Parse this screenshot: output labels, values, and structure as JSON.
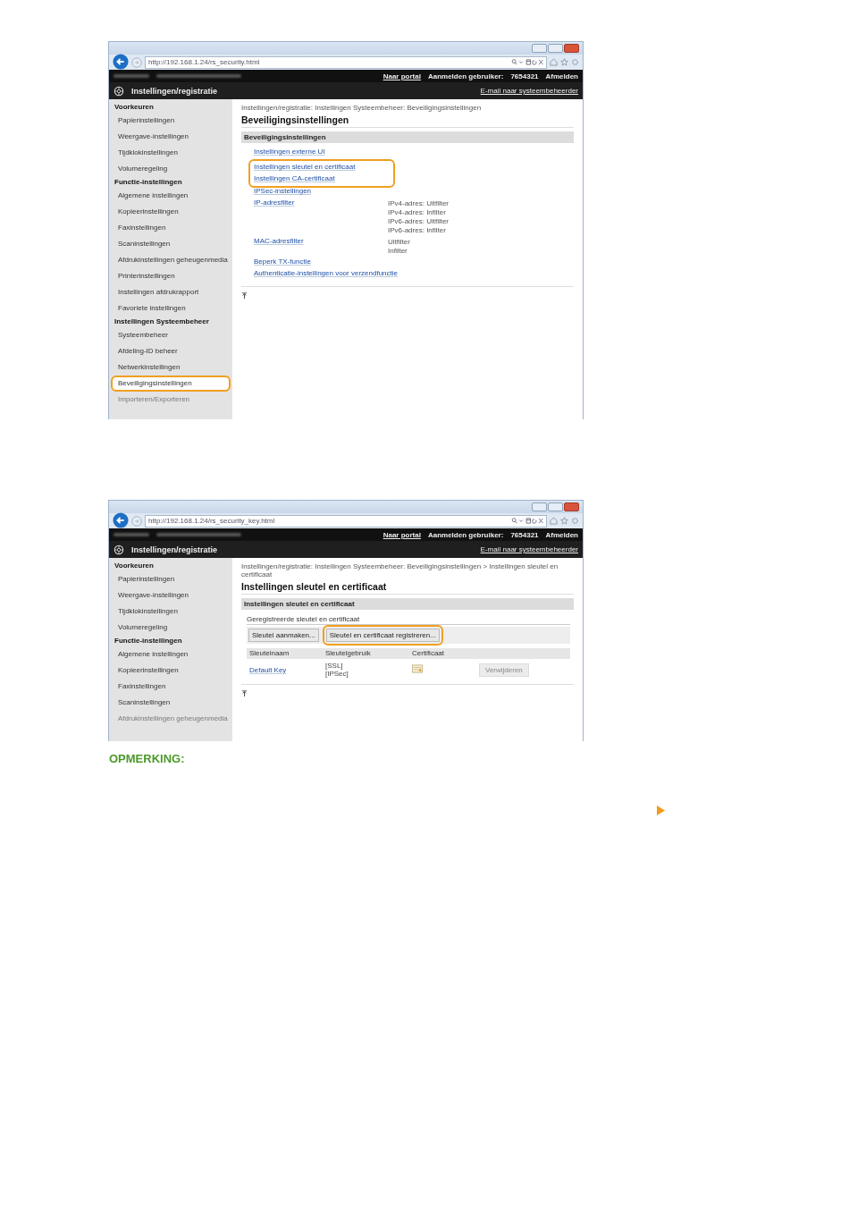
{
  "screenshots": [
    {
      "kind": "security",
      "address": "http://192.168.1.24/rs_security.html",
      "top_links": {
        "portal": "Naar portal",
        "user_label": "Aanmelden gebruiker:",
        "user_value": "7654321",
        "logout": "Afmelden"
      },
      "app_title": "Instellingen/registratie",
      "admin_email": "E-mail naar systeembeheerder",
      "sidebar": [
        {
          "kind": "heading",
          "label": "Voorkeuren"
        },
        {
          "kind": "item",
          "label": "Papierinstellingen",
          "highlighted": false,
          "faded": false
        },
        {
          "kind": "item",
          "label": "Weergave-instellingen",
          "highlighted": false,
          "faded": false
        },
        {
          "kind": "item",
          "label": "Tijdklokinstellingen",
          "highlighted": false,
          "faded": false
        },
        {
          "kind": "item",
          "label": "Volumeregeling",
          "highlighted": false,
          "faded": false
        },
        {
          "kind": "heading",
          "label": "Functie-instellingen"
        },
        {
          "kind": "item",
          "label": "Algemene instellingen",
          "highlighted": false,
          "faded": false
        },
        {
          "kind": "item",
          "label": "Kopieerinstellingen",
          "highlighted": false,
          "faded": false
        },
        {
          "kind": "item",
          "label": "Faxinstellingen",
          "highlighted": false,
          "faded": false
        },
        {
          "kind": "item",
          "label": "Scaninstellingen",
          "highlighted": false,
          "faded": false
        },
        {
          "kind": "item",
          "label": "Afdrukinstellingen geheugenmedia",
          "highlighted": false,
          "faded": false
        },
        {
          "kind": "item",
          "label": "Printerinstellingen",
          "highlighted": false,
          "faded": false
        },
        {
          "kind": "item",
          "label": "Instellingen afdrukrapport",
          "highlighted": false,
          "faded": false
        },
        {
          "kind": "item",
          "label": "Favoriete instellingen",
          "highlighted": false,
          "faded": false
        },
        {
          "kind": "heading",
          "label": "Instellingen Systeembeheer"
        },
        {
          "kind": "item",
          "label": "Systeembeheer",
          "highlighted": false,
          "faded": false
        },
        {
          "kind": "item",
          "label": "Afdeling-ID beheer",
          "highlighted": false,
          "faded": false
        },
        {
          "kind": "item",
          "label": "Netwerkinstellingen",
          "highlighted": false,
          "faded": false
        },
        {
          "kind": "item",
          "label": "Beveiligingsinstellingen",
          "highlighted": true,
          "faded": false
        },
        {
          "kind": "item",
          "label": "Importeren/Exporteren",
          "highlighted": false,
          "faded": true
        }
      ],
      "breadcrumb": "Instellingen/registratie: Instellingen Systeembeheer: Beveiligingsinstellingen",
      "title": "Beveiligingsinstellingen",
      "section": "Beveiligingsinstellingen",
      "links": [
        {
          "label": "Instellingen externe UI",
          "highlighted": false
        },
        {
          "label": "Instellingen sleutel en certificaat",
          "highlighted": true
        },
        {
          "label": "Instellingen CA-certificaat",
          "highlighted": true
        },
        {
          "label": "IPSec-instellingen",
          "highlighted": false
        },
        {
          "label": "IP-adresfilter",
          "highlighted": false,
          "values": [
            "IPv4-adres: Uitfilter",
            "IPv4-adres: Infilter",
            "IPv6-adres: Uitfilter",
            "IPv6-adres: Infilter"
          ]
        },
        {
          "label": "MAC-adresfilter",
          "highlighted": false,
          "values": [
            "Uitfilter",
            "Infilter"
          ]
        },
        {
          "label": "Beperk TX-functie",
          "highlighted": false
        },
        {
          "label": "Authenticatie-instellingen voor verzendfunctie",
          "highlighted": false
        }
      ]
    },
    {
      "kind": "keys",
      "address": "http://192.168.1.24/rs_security_key.html",
      "top_links": {
        "portal": "Naar portal",
        "user_label": "Aanmelden gebruiker:",
        "user_value": "7654321",
        "logout": "Afmelden"
      },
      "app_title": "Instellingen/registratie",
      "admin_email": "E-mail naar systeembeheerder",
      "sidebar": [
        {
          "kind": "heading",
          "label": "Voorkeuren"
        },
        {
          "kind": "item",
          "label": "Papierinstellingen",
          "highlighted": false,
          "faded": false
        },
        {
          "kind": "item",
          "label": "Weergave-instellingen",
          "highlighted": false,
          "faded": false
        },
        {
          "kind": "item",
          "label": "Tijdklokinstellingen",
          "highlighted": false,
          "faded": false
        },
        {
          "kind": "item",
          "label": "Volumeregeling",
          "highlighted": false,
          "faded": false
        },
        {
          "kind": "heading",
          "label": "Functie-instellingen"
        },
        {
          "kind": "item",
          "label": "Algemene instellingen",
          "highlighted": false,
          "faded": false
        },
        {
          "kind": "item",
          "label": "Kopieerinstellingen",
          "highlighted": false,
          "faded": false
        },
        {
          "kind": "item",
          "label": "Faxinstellingen",
          "highlighted": false,
          "faded": false
        },
        {
          "kind": "item",
          "label": "Scaninstellingen",
          "highlighted": false,
          "faded": false
        },
        {
          "kind": "item",
          "label": "Afdrukinstellingen geheugenmedia",
          "highlighted": false,
          "faded": true
        }
      ],
      "breadcrumb": "Instellingen/registratie: Instellingen Systeembeheer: Beveiligingsinstellingen > Instellingen sleutel en certificaat",
      "title": "Instellingen sleutel en certificaat",
      "section": "Instellingen sleutel en certificaat",
      "subsection": "Geregistreerde sleutel en certificaat",
      "buttons": [
        {
          "label": "Sleutel aanmaken...",
          "highlighted": false
        },
        {
          "label": "Sleutel en certificaat registreren...",
          "highlighted": true
        }
      ],
      "columns": [
        "Sleutelnaam",
        "Sleutelgebruik",
        "Certificaat"
      ],
      "rows": [
        {
          "name": "Default Key",
          "usage": [
            "[SSL]",
            "[IPSec]"
          ],
          "action": "Verwijderen",
          "action_disabled": true
        }
      ]
    }
  ],
  "note_heading": "OPMERKING:"
}
